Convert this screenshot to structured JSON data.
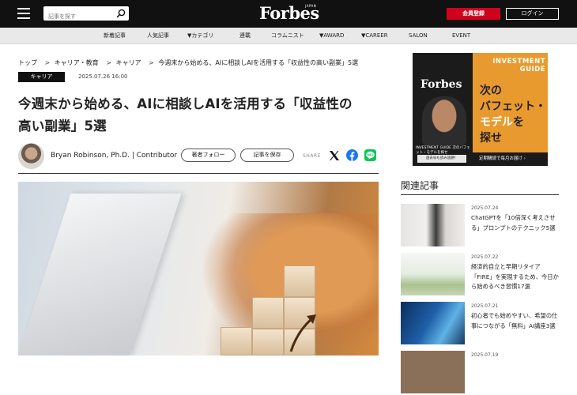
{
  "header": {
    "search_placeholder": "記事を探す",
    "logo": "Forbes",
    "logo_sub": "JAPAN",
    "register_label": "会員登録",
    "login_label": "ログイン"
  },
  "nav": {
    "items": [
      "新着記事",
      "人気記事",
      "▼カテゴリ",
      "連載",
      "コラムニスト",
      "▼AWARD",
      "▼CAREER",
      "SALON",
      "EVENT"
    ]
  },
  "article": {
    "breadcrumb": [
      "トップ",
      "キャリア・教育",
      "キャリア",
      "今週末から始める、AIに相談しAIを活用する「収益性の高い副業」5選"
    ],
    "breadcrumb_sep": ">",
    "category": "キャリア",
    "date": "2025.07.26 16:00",
    "title_line1": "今週末から始める、AIに相談しAIを活用する「収益性の",
    "title_line2": "高い副業」5選",
    "author": "Bryan Robinson, Ph.D. | Contributor",
    "follow_label": "著者フォロー",
    "save_label": "記事を保存",
    "share_label": "SHARE"
  },
  "ad": {
    "title_line1": "INVESTMENT",
    "title_line2": "GUIDE",
    "magazine": "Forbes",
    "magazine_sub": "INVESTMENT GUIDE 次のバフェット・モデルを探せ",
    "copy_line1": "次の",
    "copy_line2": "バフェット・",
    "copy_line3a": "モデル",
    "copy_line3b": "を",
    "copy_line4": "探せ",
    "tag1": "過去号も読み放題！",
    "tag2": "定期購読で毎月お届け ›"
  },
  "related": {
    "heading": "関連記事",
    "items": [
      {
        "date": "2025.07.24",
        "title": "ChatGPTを「10倍深く考えさせる」プロンプトのテクニック5選"
      },
      {
        "date": "2025.07.22",
        "title": "経済的自立と早期リタイア「FIRE」を実現するため、今日から始めるべき習慣17選"
      },
      {
        "date": "2025.07.21",
        "title": "初心者でも始めやすい、希望の仕事につながる「無料」AI講座3選"
      },
      {
        "date": "2025.07.19",
        "title": ""
      }
    ]
  },
  "colors": {
    "brand_red": "#d0021b",
    "ad_orange": "#e89a2e",
    "facebook": "#1877f2",
    "line": "#06c755"
  }
}
